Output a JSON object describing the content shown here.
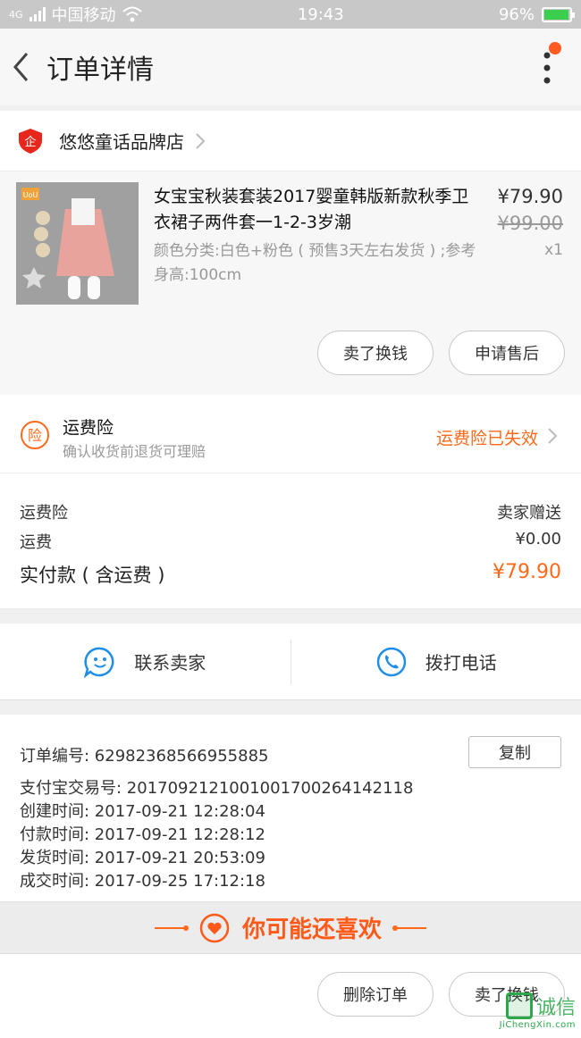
{
  "status_bar": {
    "network": "4G",
    "carrier": "中国移动",
    "time": "19:43",
    "battery_percent": "96%",
    "battery_level": 0.96
  },
  "header": {
    "title": "订单详情"
  },
  "shop": {
    "name": "悠悠童话品牌店"
  },
  "product": {
    "title": "女宝宝秋装套装2017婴童韩版新款秋季卫衣裙子两件套一1-2-3岁潮",
    "sku": "颜色分类:白色+粉色 ( 预售3天左右发货 ) ;参考身高:100cm",
    "price": "¥79.90",
    "original_price": "¥99.00",
    "quantity": "x1",
    "image_logo": "UoU",
    "buttons": {
      "sell_label": "卖了换钱",
      "after_sale_label": "申请售后"
    }
  },
  "insurance": {
    "icon_char": "险",
    "title": "运费险",
    "subtitle": "确认收货前退货可理赔",
    "status": "运费险已失效"
  },
  "fees": {
    "rows": [
      {
        "label": "运费险",
        "value": "卖家赠送"
      },
      {
        "label": "运费",
        "value": "¥0.00"
      }
    ],
    "total_label": "实付款 ( 含运费 )",
    "total_value": "¥79.90"
  },
  "contact": {
    "seller_label": "联系卖家",
    "phone_label": "拨打电话"
  },
  "order_info": {
    "copy_label": "复制",
    "lines": [
      "订单编号:   62982368566955885",
      "支付宝交易号:   2017092121001001700264142118",
      "创建时间:   2017-09-21 12:28:04",
      "付款时间:   2017-09-21 12:28:12",
      "发货时间:   2017-09-21 20:53:09",
      "成交时间:   2017-09-25 17:12:18"
    ]
  },
  "recommend": {
    "label": "你可能还喜欢"
  },
  "bottom": {
    "delete_label": "删除订单",
    "sell_label": "卖了换钱"
  },
  "watermark": {
    "main": "诚信",
    "sub": "JiChengXin.com"
  },
  "colors": {
    "accent": "#ff6a1a",
    "brand_red": "#e8271c",
    "contact_blue": "#1f8ee8"
  }
}
